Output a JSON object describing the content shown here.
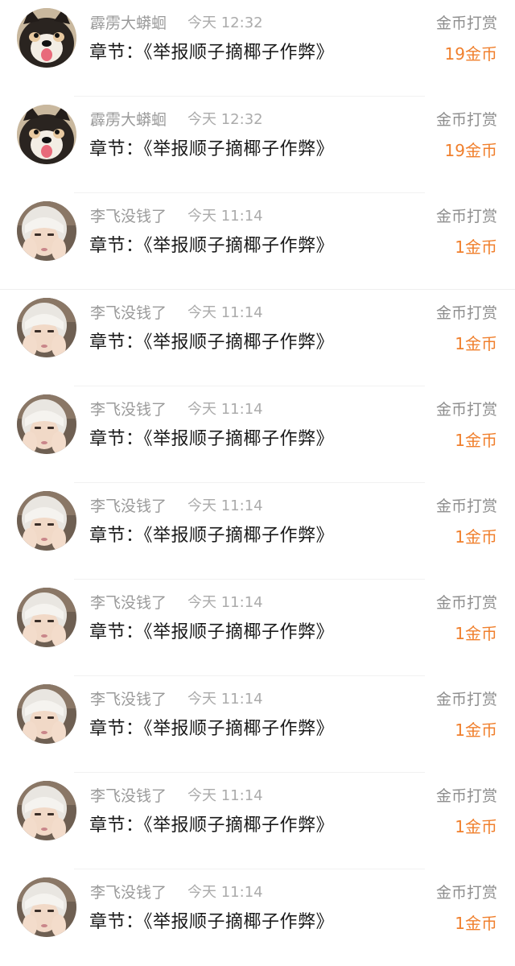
{
  "colors": {
    "coins": "#f07f2c",
    "name": "#9a9a9a",
    "chapter": "#1a1a1a"
  },
  "rewards": [
    {
      "user": "霹雳大蟒蛔",
      "time": "今天 12:32",
      "chapter": "章节：《举报顺子摘椰子作弊》",
      "type": "金币打赏",
      "amount": "19金币",
      "avatar": "dog-avatar"
    },
    {
      "user": "霹雳大蟒蛔",
      "time": "今天 12:32",
      "chapter": "章节：《举报顺子摘椰子作弊》",
      "type": "金币打赏",
      "amount": "19金币",
      "avatar": "dog-avatar"
    },
    {
      "user": "李飞没钱了",
      "time": "今天 11:14",
      "chapter": "章节：《举报顺子摘椰子作弊》",
      "type": "金币打赏",
      "amount": "1金币",
      "avatar": "hooded-person-avatar"
    },
    {
      "user": "李飞没钱了",
      "time": "今天 11:14",
      "chapter": "章节：《举报顺子摘椰子作弊》",
      "type": "金币打赏",
      "amount": "1金币",
      "avatar": "hooded-person-avatar"
    },
    {
      "user": "李飞没钱了",
      "time": "今天 11:14",
      "chapter": "章节：《举报顺子摘椰子作弊》",
      "type": "金币打赏",
      "amount": "1金币",
      "avatar": "hooded-person-avatar"
    },
    {
      "user": "李飞没钱了",
      "time": "今天 11:14",
      "chapter": "章节：《举报顺子摘椰子作弊》",
      "type": "金币打赏",
      "amount": "1金币",
      "avatar": "hooded-person-avatar"
    },
    {
      "user": "李飞没钱了",
      "time": "今天 11:14",
      "chapter": "章节：《举报顺子摘椰子作弊》",
      "type": "金币打赏",
      "amount": "1金币",
      "avatar": "hooded-person-avatar"
    },
    {
      "user": "李飞没钱了",
      "time": "今天 11:14",
      "chapter": "章节：《举报顺子摘椰子作弊》",
      "type": "金币打赏",
      "amount": "1金币",
      "avatar": "hooded-person-avatar"
    },
    {
      "user": "李飞没钱了",
      "time": "今天 11:14",
      "chapter": "章节：《举报顺子摘椰子作弊》",
      "type": "金币打赏",
      "amount": "1金币",
      "avatar": "hooded-person-avatar"
    },
    {
      "user": "李飞没钱了",
      "time": "今天 11:14",
      "chapter": "章节：《举报顺子摘椰子作弊》",
      "type": "金币打赏",
      "amount": "1金币",
      "avatar": "hooded-person-avatar"
    }
  ]
}
